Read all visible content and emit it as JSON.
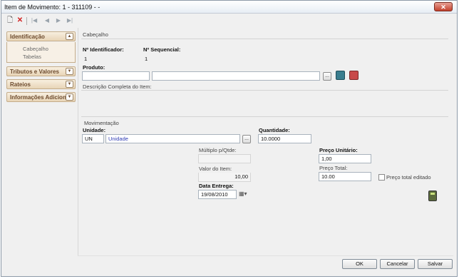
{
  "window": {
    "title": "Item de Movimento: 1 - 311109 -  -"
  },
  "toolbar": {
    "new": "🗋",
    "delete": "✕",
    "first": "|◀",
    "prev": "◀",
    "next": "▶",
    "last": "▶|"
  },
  "sidebar": {
    "identificacao": {
      "label": "Identificação",
      "items": [
        "Cabeçalho",
        "Tabelas"
      ]
    },
    "tributos": {
      "label": "Tributos e Valores"
    },
    "rateios": {
      "label": "Rateios"
    },
    "info": {
      "label": "Informações Adicion:"
    }
  },
  "cabecalho": {
    "section_title": "Cabeçalho",
    "id_label": "Nº Identificador:",
    "id_value": "1",
    "seq_label": "Nº Sequencial:",
    "seq_value": "1",
    "produto_label": "Produto:",
    "produto_code": "",
    "produto_name": "",
    "lookup_btn": "...",
    "desc_label": "Descrição Completa do Item:",
    "desc_value": ""
  },
  "movimentacao": {
    "section_title": "Movimentação",
    "unidade_label": "Unidade:",
    "unidade_code": "UN",
    "unidade_name": "Unidade",
    "lookup_btn": "...",
    "quantidade_label": "Quantidade:",
    "quantidade_value": "10.0000",
    "multiplo_label": "Múltiplo p/Qtde:",
    "multiplo_value": "",
    "preco_unit_label": "Preço Unitário:",
    "preco_unit_value": "1,00",
    "valor_item_label": "Valor do Item:",
    "valor_item_value": "10,00",
    "preco_total_label": "Preço Total:",
    "preco_total_value": "10.00",
    "preco_total_editado_label": "Preço total editado",
    "data_entrega_label": "Data Entrega:",
    "data_entrega_value": "19/08/2010",
    "calendar_icon": "▦▾"
  },
  "footer": {
    "ok": "OK",
    "cancel": "Cancelar",
    "save": "Salvar"
  },
  "colors": {
    "panel_head": "#e8d4b6",
    "link": "#2f3cb4",
    "close": "#c2402c"
  }
}
